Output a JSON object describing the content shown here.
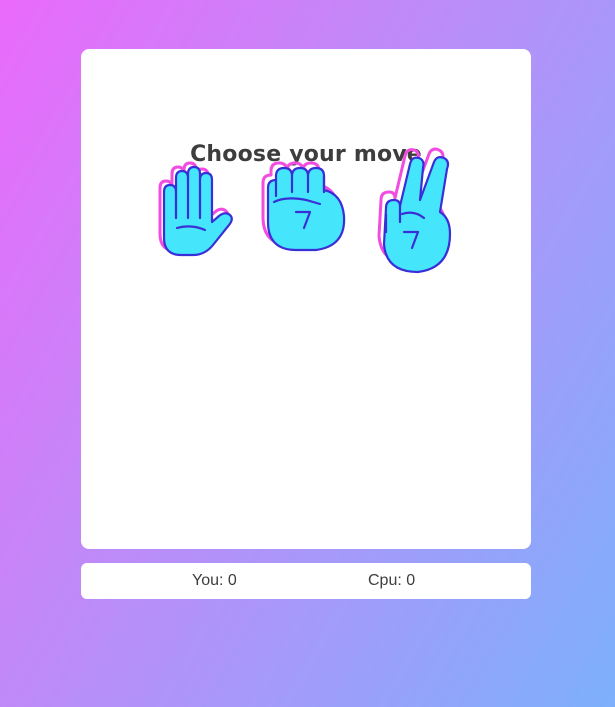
{
  "game": {
    "title": "Choose your move",
    "moves": [
      {
        "id": "paper",
        "icon": "open-hand-icon"
      },
      {
        "id": "rock",
        "icon": "fist-icon"
      },
      {
        "id": "scissors",
        "icon": "victory-hand-icon"
      }
    ]
  },
  "score": {
    "you_label": "You:",
    "you_value": "0",
    "cpu_label": "Cpu:",
    "cpu_value": "0"
  },
  "colors": {
    "hand_fill": "#45e6fb",
    "hand_outline": "#3a2fd6",
    "hand_shadow": "#f24de0"
  }
}
